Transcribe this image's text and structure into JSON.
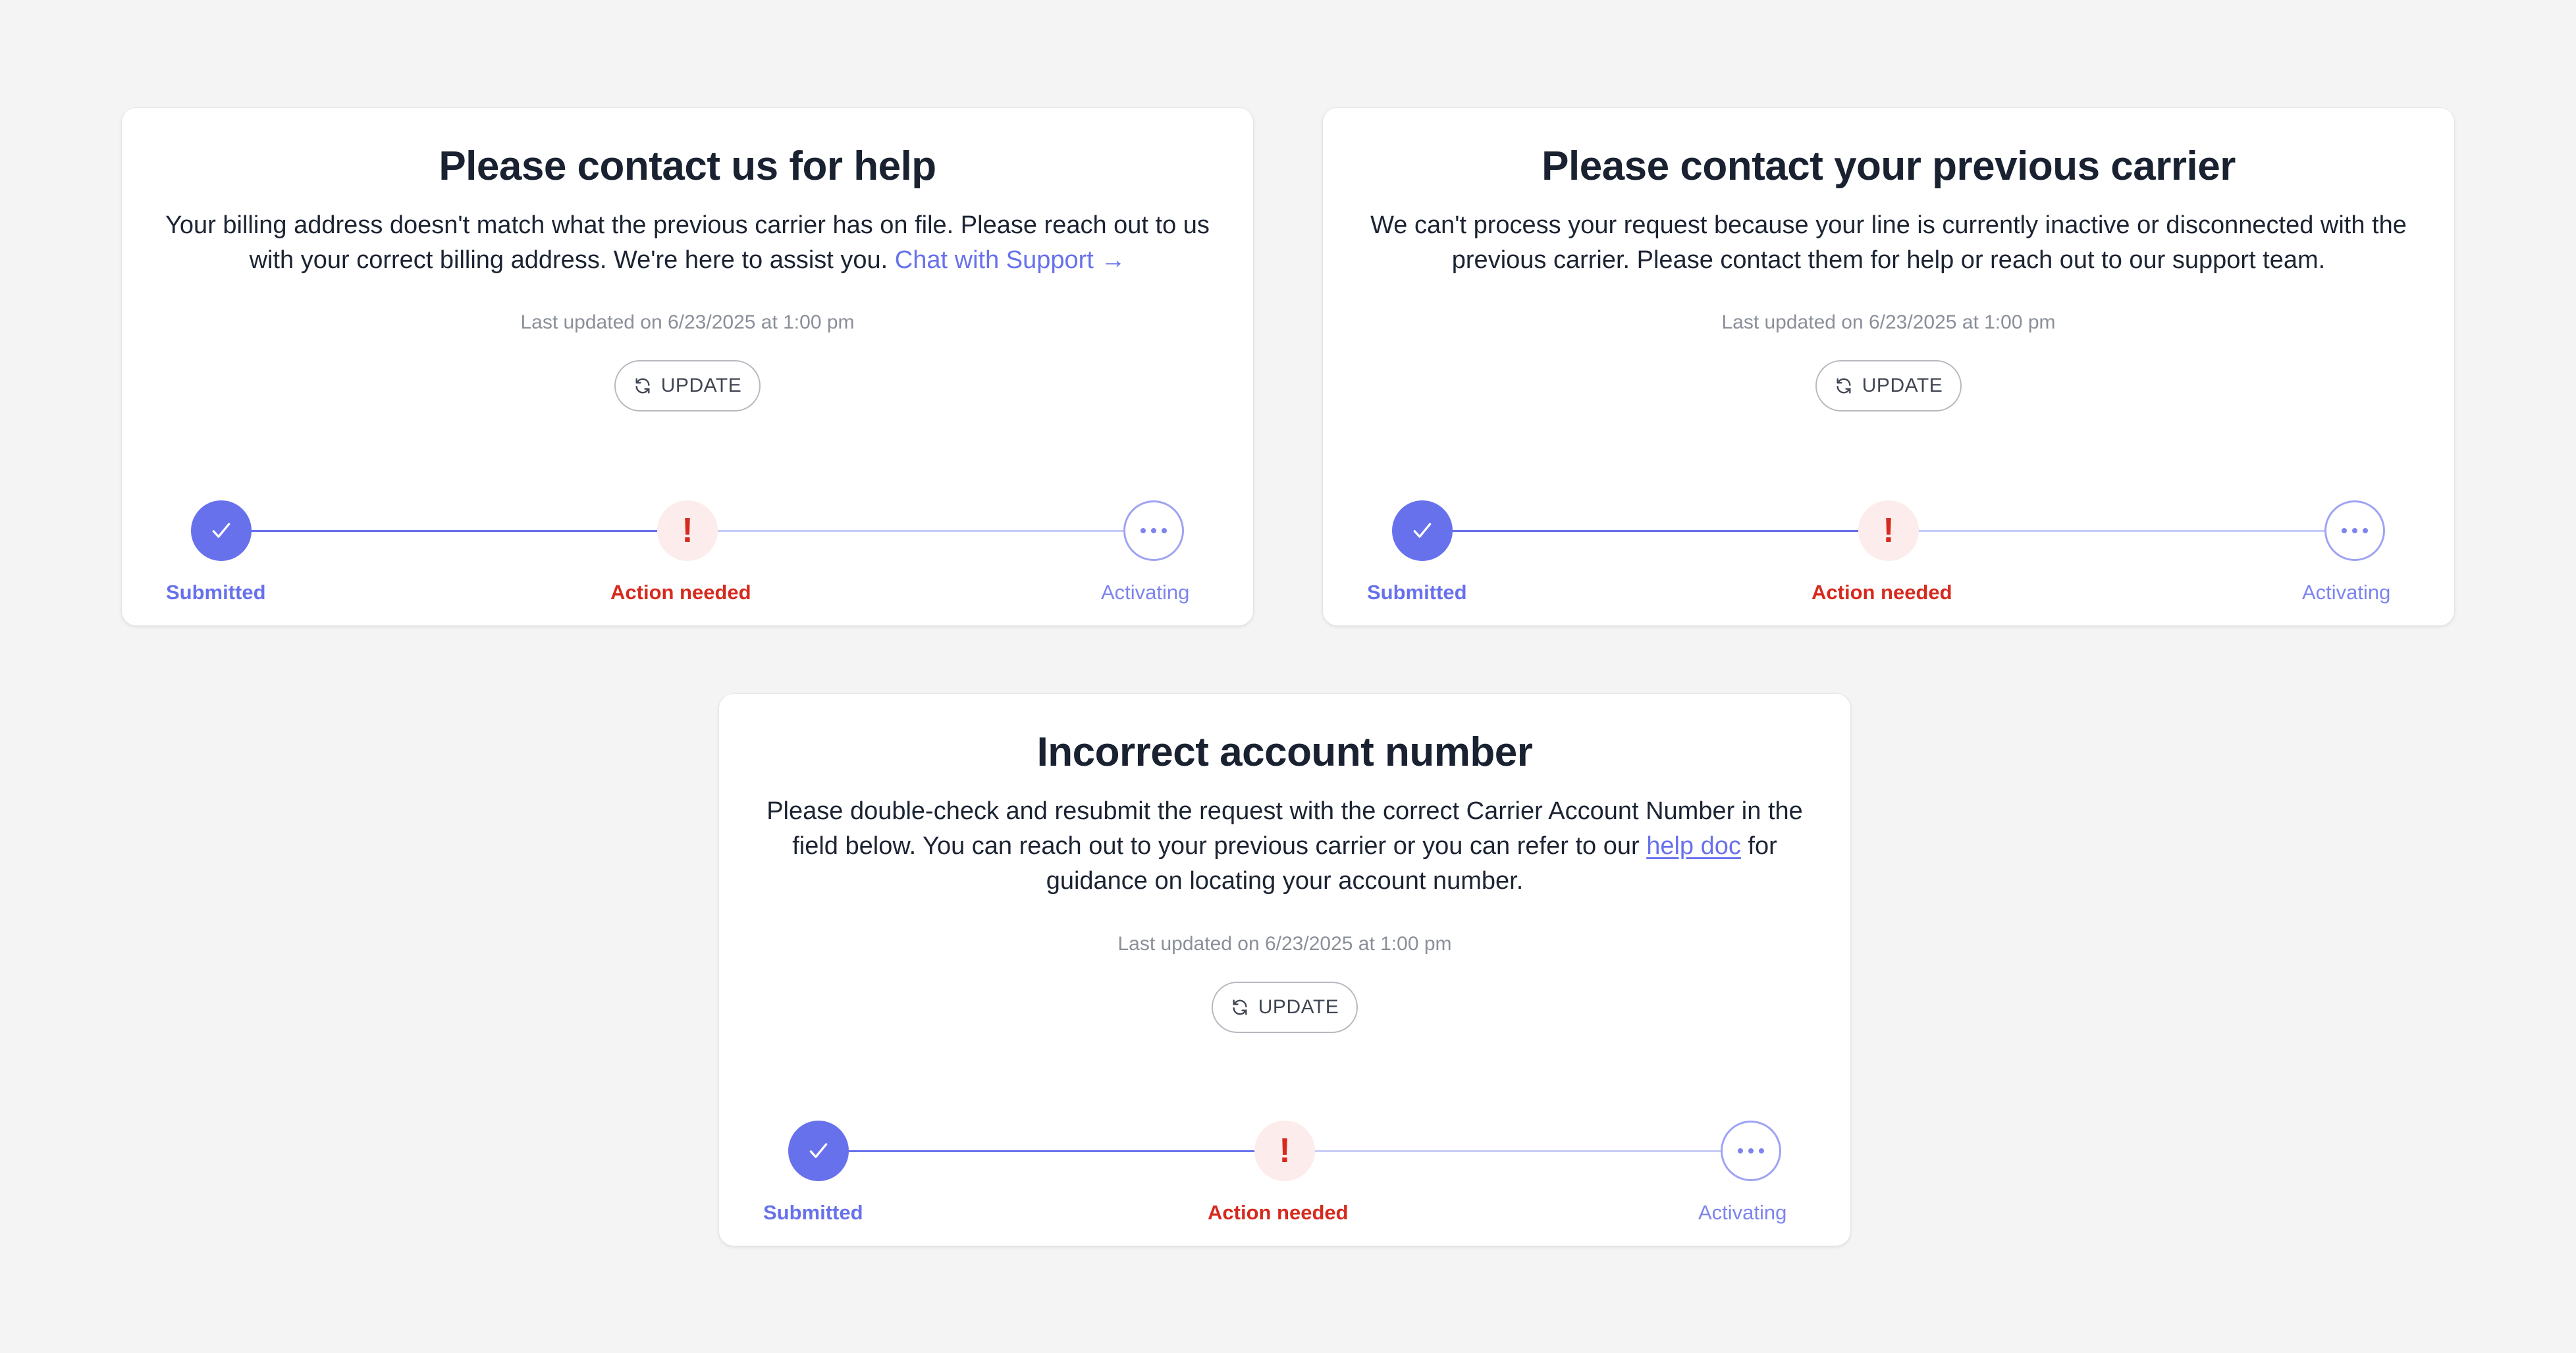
{
  "colors": {
    "background": "#f4f4f5",
    "accent": "#6871ec",
    "accent_light": "#c8ccf6",
    "warning": "#d62a1e",
    "warning_bg": "#fdecec",
    "text_primary": "#1a2231",
    "text_muted": "#8a8f99"
  },
  "cards": [
    {
      "title": "Please contact us for help",
      "body": "Your billing address doesn't match what the previous carrier has on file. Please reach out to us with your correct billing address. We're here to assist you. ",
      "link_text": "Chat with Support →",
      "last_updated": "Last updated on 6/23/2025 at 1:00 pm",
      "update_label": "UPDATE",
      "steps": [
        {
          "label": "Submitted",
          "state": "done",
          "icon": "check-icon"
        },
        {
          "label": "Action needed",
          "state": "warning",
          "icon": "exclamation-icon"
        },
        {
          "label": "Activating",
          "state": "pending",
          "icon": "more-dots-icon"
        }
      ]
    },
    {
      "title": "Please contact your previous carrier",
      "body": "We can't process your request because your line is currently inactive or disconnected with the previous carrier. Please contact them for help or reach out to our support team.",
      "last_updated": "Last updated on 6/23/2025 at 1:00 pm",
      "update_label": "UPDATE",
      "steps": [
        {
          "label": "Submitted",
          "state": "done",
          "icon": "check-icon"
        },
        {
          "label": "Action needed",
          "state": "warning",
          "icon": "exclamation-icon"
        },
        {
          "label": "Activating",
          "state": "pending",
          "icon": "more-dots-icon"
        }
      ]
    },
    {
      "title": "Incorrect account number",
      "body_before": "Please double-check and resubmit the request with the correct Carrier Account Number in the field below. You can reach out to your previous carrier or you can refer to our ",
      "link_text": "help doc",
      "body_after": " for guidance on locating your account number.",
      "last_updated": "Last updated on 6/23/2025 at 1:00 pm",
      "update_label": "UPDATE",
      "steps": [
        {
          "label": "Submitted",
          "state": "done",
          "icon": "check-icon"
        },
        {
          "label": "Action needed",
          "state": "warning",
          "icon": "exclamation-icon"
        },
        {
          "label": "Activating",
          "state": "pending",
          "icon": "more-dots-icon"
        }
      ]
    }
  ]
}
